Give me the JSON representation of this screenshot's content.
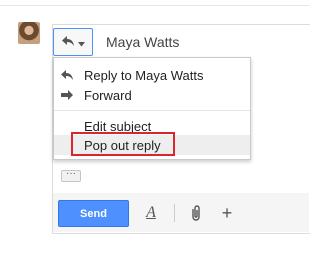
{
  "recipient": "Maya Watts",
  "menu": {
    "reply_label": "Reply to Maya Watts",
    "forward_label": "Forward",
    "edit_subject_label": "Edit subject",
    "pop_out_label": "Pop out reply"
  },
  "more_label": "···",
  "toolbar": {
    "send_label": "Send",
    "format_label": "A",
    "add_label": "+"
  },
  "icons": {
    "reply": "reply-icon",
    "forward": "forward-icon",
    "dropdown": "chevron-down-icon",
    "attach": "paperclip-icon",
    "format": "text-format-icon",
    "add": "plus-icon"
  },
  "colors": {
    "send_button": "#4d90fe",
    "highlight_box": "#d9252c",
    "menu_hover": "#eeeeee"
  }
}
